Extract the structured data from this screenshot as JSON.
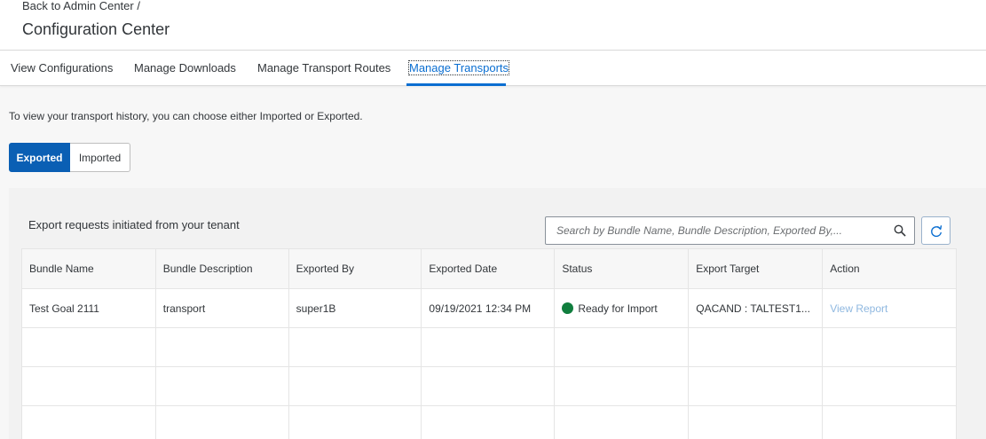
{
  "header": {
    "breadcrumb_link": "Back to Admin Center",
    "breadcrumb_sep": " /",
    "title": "Configuration Center"
  },
  "tabs": [
    {
      "label": "View Configurations"
    },
    {
      "label": "Manage Downloads"
    },
    {
      "label": "Manage Transport Routes"
    },
    {
      "label": "Manage Transports",
      "active": true
    }
  ],
  "intro_text": "To view your transport history, you can choose either Imported or Exported.",
  "toggle": {
    "exported": "Exported",
    "imported": "Imported",
    "selected": "Exported"
  },
  "table": {
    "title": "Export requests initiated from your tenant",
    "search_placeholder": "Search by Bundle Name, Bundle Description, Exported By,...",
    "columns": [
      "Bundle Name",
      "Bundle Description",
      "Exported By",
      "Exported Date",
      "Status",
      "Export Target",
      "Action"
    ],
    "rows": [
      {
        "bundle_name": "Test Goal 2111",
        "bundle_description": "transport",
        "exported_by": "super1B",
        "exported_date": "09/19/2021 12:34 PM",
        "status": "Ready for Import",
        "export_target": "QACAND : TALTEST1...",
        "action": "View Report"
      }
    ]
  },
  "colors": {
    "accent": "#0a6ed1",
    "selected_button": "#0a5fb4",
    "status_success": "#107e3e",
    "link_disabled": "#8fb8e0"
  },
  "icons": {
    "search": "search-icon",
    "refresh": "refresh-icon",
    "status": "status-dot-icon"
  }
}
